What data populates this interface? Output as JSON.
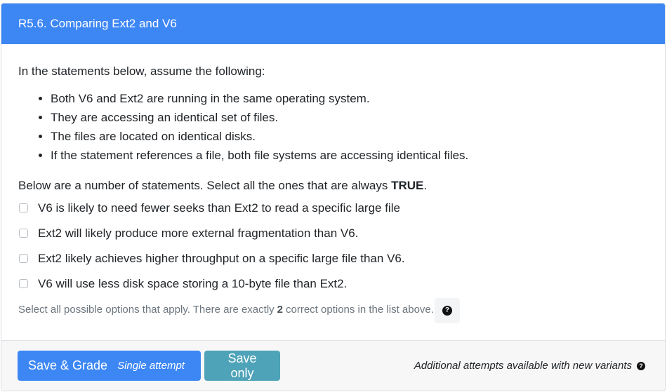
{
  "header": {
    "title": "R5.6. Comparing Ext2 and V6"
  },
  "body": {
    "intro": "In the statements below, assume the following:",
    "assumptions": [
      "Both V6 and Ext2 are running in the same operating system.",
      "They are accessing an identical set of files.",
      "The files are located on identical disks.",
      "If the statement references a file, both file systems are accessing identical files."
    ],
    "prompt_prefix": "Below are a number of statements. Select all the ones that are always",
    "prompt_emphasis": "TRUE",
    "prompt_suffix": ".",
    "options": [
      {
        "label": "V6 is likely to need fewer seeks than Ext2 to read a specific large file",
        "checked": false
      },
      {
        "label": "Ext2 will likely produce more external fragmentation than V6.",
        "checked": false
      },
      {
        "label": "Ext2 likely achieves higher throughput on a specific large file than V6.",
        "checked": false
      },
      {
        "label": "V6 will use less disk space storing a 10-byte file than Ext2.",
        "checked": false
      }
    ],
    "help_prefix": "Select all possible options that apply. There are exactly",
    "help_count": "2",
    "help_suffix": "correct options in the list above.",
    "help_icon": "question-circle-icon"
  },
  "footer": {
    "grade_label": "Save & Grade",
    "grade_sub": "Single attempt",
    "save_label": "Save only",
    "note": "Additional attempts available with new variants"
  },
  "colors": {
    "header_bg": "#3d87f5",
    "primary_button": "#3d87f5",
    "info_button": "#4ea3b8"
  }
}
